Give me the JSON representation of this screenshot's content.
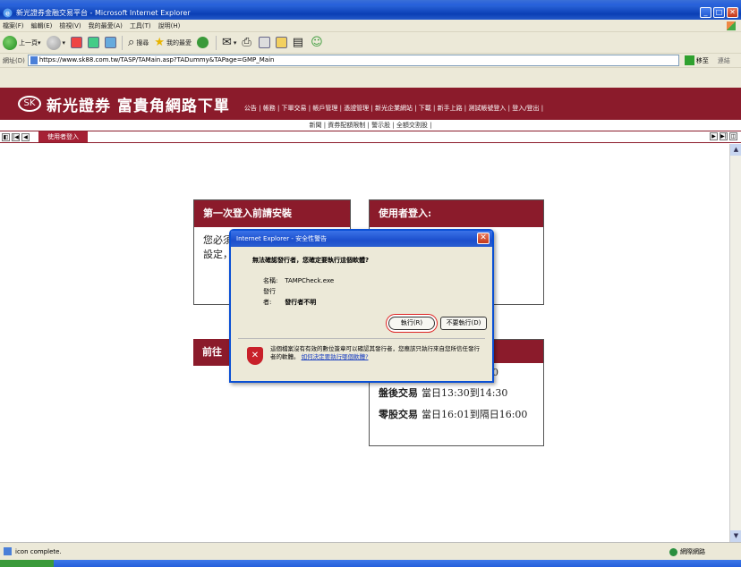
{
  "window": {
    "title": "新光證券金融交易平台 - Microsoft Internet Explorer",
    "controls": [
      "_",
      "□",
      "✕"
    ]
  },
  "menubar": [
    "檔案(F)",
    "編輯(E)",
    "檢視(V)",
    "我的最愛(A)",
    "工具(T)",
    "說明(H)"
  ],
  "toolbar": {
    "back": "上一頁",
    "search": "搜尋",
    "favorites": "我的最愛"
  },
  "address": {
    "label": "網址(D)",
    "url": "https://www.sk88.com.tw/TASP/TAMain.asp?TADummy&TAPage=GMP_Main",
    "go": "移至",
    "links": "連結"
  },
  "site": {
    "logo": "SK",
    "name": "新光證券  富貴角網路下單",
    "nav": "公告 | 帳務 | 下單交易 | 帳戶管理 | 憑證管理 | 新光企業網站 | 下載 | 新手上路 | 測試帳號登入 | 登入/登出 |",
    "subnav": "新聞 | 資券配額限制 | 警示股 | 全額交割股 |"
  },
  "tabs": {
    "active": "使用者登入",
    "left_buttons": [
      "◧",
      "|◀",
      "◀"
    ],
    "right_buttons": [
      "▶",
      "▶|",
      "◫"
    ]
  },
  "panels": {
    "first_login": {
      "title": "第一次登入前請安裝",
      "body": "您必須",
      "body2": "設定，"
    },
    "user_login": {
      "title": "使用者登入:"
    },
    "goto": {
      "title": "前往"
    },
    "trading": {
      "partial_time": "3:30",
      "rows": [
        {
          "name": "盤後交易",
          "time": "當日13:30到14:30"
        },
        {
          "name": "零股交易",
          "time": "當日16:01到隔日16:00"
        }
      ]
    }
  },
  "dialog": {
    "title": "Internet Explorer - 安全性警告",
    "question": "無法確認發行者，您確定要執行這個軟體?",
    "name_label": "名稱:",
    "name_value": "TAMPCheck.exe",
    "publisher_label": "發行者:",
    "publisher_value": "發行者不明",
    "run_button": "執行(R)",
    "dont_run_button": "不要執行(D)",
    "warning_text": "這個檔案沒有有效的數位簽章可以確認其發行者，您應該只執行來自您所信任發行者的軟體。",
    "warning_link": "如何決定要執行哪個軟體?"
  },
  "status": {
    "text": "icon complete.",
    "zone": "網際網路"
  }
}
